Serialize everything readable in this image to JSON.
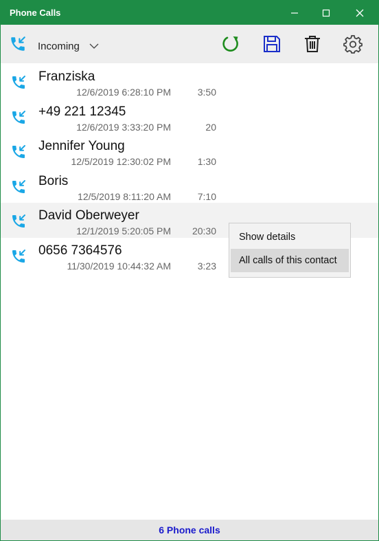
{
  "window": {
    "title": "Phone Calls"
  },
  "toolbar": {
    "filter_label": "Incoming"
  },
  "calls": [
    {
      "name": "Franziska",
      "datetime": "12/6/2019 6:28:10 PM",
      "duration": "3:50"
    },
    {
      "name": "+49 221 12345",
      "datetime": "12/6/2019 3:33:20 PM",
      "duration": "20"
    },
    {
      "name": "Jennifer Young",
      "datetime": "12/5/2019 12:30:02 PM",
      "duration": "1:30"
    },
    {
      "name": "Boris",
      "datetime": "12/5/2019 8:11:20 AM",
      "duration": "7:10"
    },
    {
      "name": "David Oberweyer",
      "datetime": "12/1/2019 5:20:05 PM",
      "duration": "20:30"
    },
    {
      "name": "0656 7364576",
      "datetime": "11/30/2019 10:44:32 AM",
      "duration": "3:23"
    }
  ],
  "context_menu": {
    "items": [
      "Show details",
      "All calls of this contact"
    ]
  },
  "status": {
    "text": "6 Phone calls"
  },
  "colors": {
    "accent_green": "#1e8c46",
    "call_icon": "#1aa7e6",
    "save_icon": "#1a2ec9",
    "status_text": "#1a1acc"
  },
  "icons": {
    "call": "incoming-call-icon",
    "refresh": "refresh-icon",
    "save": "save-icon",
    "delete": "trash-icon",
    "settings": "gear-icon"
  }
}
